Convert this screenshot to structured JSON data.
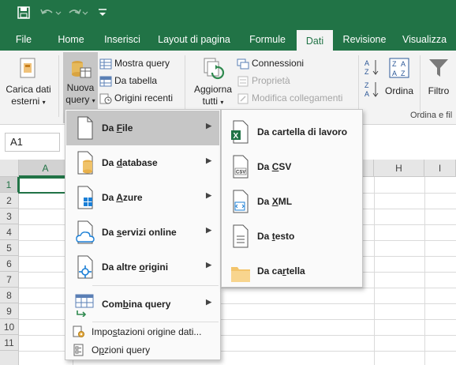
{
  "quick_access": {
    "save_icon": "save-icon",
    "undo_icon": "undo-icon",
    "redo_icon": "redo-icon",
    "customize_icon": "customize-qat-icon"
  },
  "tabs": [
    {
      "label": "File"
    },
    {
      "label": "Home"
    },
    {
      "label": "Inserisci"
    },
    {
      "label": "Layout di pagina"
    },
    {
      "label": "Formule"
    },
    {
      "label": "Dati",
      "active": true
    },
    {
      "label": "Revisione"
    },
    {
      "label": "Visualizza"
    }
  ],
  "ribbon": {
    "carica_dati": {
      "line1": "Carica dati",
      "line2": "esterni"
    },
    "nuova_query": {
      "line1": "Nuova",
      "line2": "query"
    },
    "mostra_query": "Mostra query",
    "da_tabella": "Da tabella",
    "origini_recenti": "Origini recenti",
    "aggiorna_tutti": {
      "line1": "Aggiorna",
      "line2": "tutti"
    },
    "connessioni": "Connessioni",
    "proprieta": "Proprietà",
    "modifica_collegamenti": "Modifica collegamenti",
    "ordina": "Ordina",
    "filtro": "Filtro",
    "group_ordina": "Ordina e fil"
  },
  "formula_bar": {
    "name_box": "A1"
  },
  "grid": {
    "columns": [
      "A",
      "H",
      "I"
    ],
    "rows": [
      "1",
      "2",
      "3",
      "4",
      "5",
      "6",
      "7",
      "8",
      "9",
      "10",
      "11"
    ]
  },
  "menu": {
    "items": [
      {
        "label": "Da File",
        "ul": "F",
        "pre": "Da ",
        "post": "ile",
        "icon": "file-icon"
      },
      {
        "label": "Da database",
        "pre": "Da ",
        "ul": "d",
        "post": "atabase",
        "icon": "database-icon"
      },
      {
        "label": "Da Azure",
        "pre": "Da ",
        "ul": "A",
        "post": "zure",
        "icon": "azure-icon"
      },
      {
        "label": "Da servizi online",
        "pre": "Da ",
        "ul": "s",
        "post": "ervizi online",
        "icon": "cloud-icon"
      },
      {
        "label": "Da altre origini",
        "pre": "Da altre ",
        "ul": "o",
        "post": "rigini",
        "icon": "other-sources-icon"
      },
      {
        "label": "Combina query",
        "pre": "Com",
        "ul": "b",
        "post": "ina query",
        "icon": "combine-icon"
      }
    ],
    "settings": {
      "pre": "Impo",
      "ul": "s",
      "post": "tazioni origine dati...",
      "icon": "settings-icon"
    },
    "options": {
      "pre": "O",
      "ul": "p",
      "post": "zioni query",
      "icon": "options-icon"
    }
  },
  "submenu": {
    "items": [
      {
        "pre": "Da cartella di lavoro",
        "ul": "",
        "post": "",
        "icon": "excel-workbook-icon"
      },
      {
        "pre": "Da ",
        "ul": "C",
        "post": "SV",
        "icon": "csv-file-icon"
      },
      {
        "pre": "Da ",
        "ul": "X",
        "post": "ML",
        "icon": "xml-file-icon"
      },
      {
        "pre": "Da ",
        "ul": "t",
        "post": "esto",
        "icon": "text-file-icon"
      },
      {
        "pre": "Da ca",
        "ul": "r",
        "post": "tella",
        "icon": "folder-icon"
      }
    ]
  },
  "colors": {
    "brand": "#217346",
    "highlight": "#c6c6c6"
  }
}
